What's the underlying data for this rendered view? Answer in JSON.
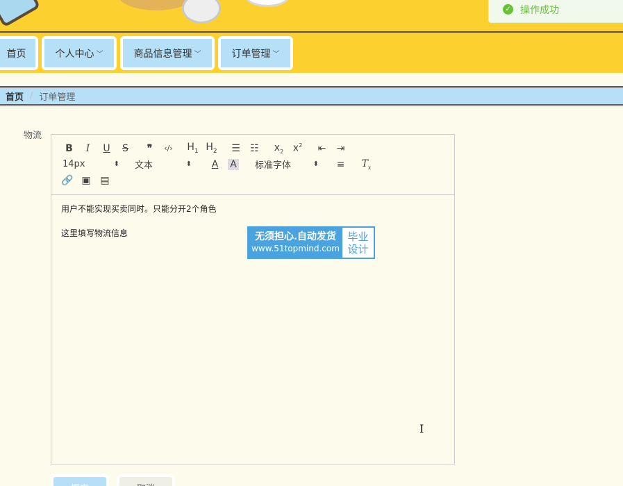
{
  "toast": {
    "message": "操作成功"
  },
  "nav": {
    "home": "首页",
    "personal": "个人中心",
    "goods": "商品信息管理",
    "orders": "订单管理"
  },
  "breadcrumb": {
    "home": "首页",
    "separator": "/",
    "current": "订单管理"
  },
  "form": {
    "logistics_label": "物流",
    "editor": {
      "font_size": "14px",
      "header_type": "文本",
      "font_family": "标准字体",
      "lines": [
        "用户不能实现买卖同时。只能分开2个角色",
        "这里填写物流信息"
      ]
    },
    "submit_label": "提交",
    "cancel_label": "取消"
  },
  "watermark": {
    "line1": "无须担心.自动发货",
    "line2": "www.51topmind.com",
    "right1": "毕业",
    "right2": "设计"
  },
  "colors": {
    "banner": "#fcd12f",
    "nav_button": "#b6e0f7",
    "page_bg": "#fdfbec",
    "success": "#67c23a"
  }
}
